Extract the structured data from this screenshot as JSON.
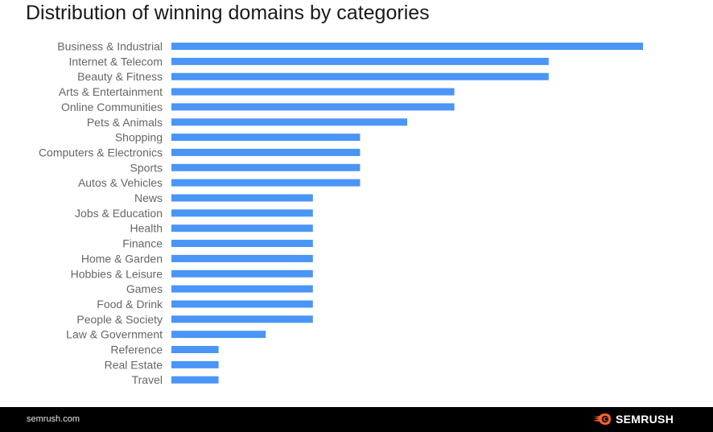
{
  "page": {
    "title": "Distribution of winning domains by categories"
  },
  "footer": {
    "url": "semrush.com",
    "brand": "SEMRUSH",
    "brand_color": "#ff642d"
  },
  "chart_data": {
    "type": "bar",
    "orientation": "horizontal",
    "title": "Distribution of winning domains by categories",
    "xlabel": "",
    "ylabel": "",
    "grid": false,
    "legend": "none",
    "bar_color": "#4a95f5",
    "xlim": [
      0,
      10
    ],
    "categories": [
      "Business & Industrial",
      "Internet & Telecom",
      "Beauty & Fitness",
      "Arts & Entertainment",
      "Online Communities",
      "Pets & Animals",
      "Shopping",
      "Computers & Electronics",
      "Sports",
      "Autos & Vehicles",
      "News",
      "Jobs & Education",
      "Health",
      "Finance",
      "Home & Garden",
      "Hobbies & Leisure",
      "Games",
      "Food & Drink",
      "People & Society",
      "Law & Government",
      "Reference",
      "Real Estate",
      "Travel"
    ],
    "values": [
      10,
      8,
      8,
      6,
      6,
      5,
      4,
      4,
      4,
      4,
      3,
      3,
      3,
      3,
      3,
      3,
      3,
      3,
      3,
      2,
      1,
      1,
      1
    ]
  }
}
